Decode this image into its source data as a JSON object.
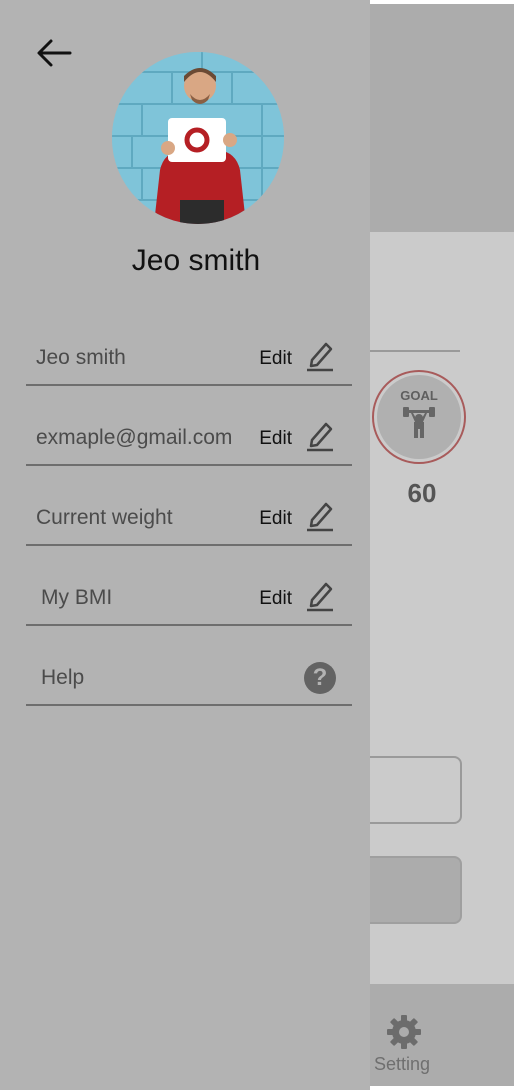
{
  "background": {
    "goal_label": "GOAL",
    "goal_value": "60",
    "setting_label": "Setting"
  },
  "drawer": {
    "profile_name": "Jeo smith",
    "fields": [
      {
        "label": "Jeo smith",
        "action": "Edit",
        "icon": "pencil-icon"
      },
      {
        "label": "exmaple@gmail.com",
        "action": "Edit",
        "icon": "pencil-icon"
      },
      {
        "label": "Current weight",
        "action": "Edit",
        "icon": "pencil-icon"
      },
      {
        "label": "My BMI",
        "action": "Edit",
        "icon": "pencil-icon"
      },
      {
        "label": "Help",
        "icon": "help-icon"
      }
    ]
  },
  "colors": {
    "drawer_bg": "#b3b3b3",
    "goal_ring": "#a85b5b",
    "help_icon": "#636363"
  }
}
